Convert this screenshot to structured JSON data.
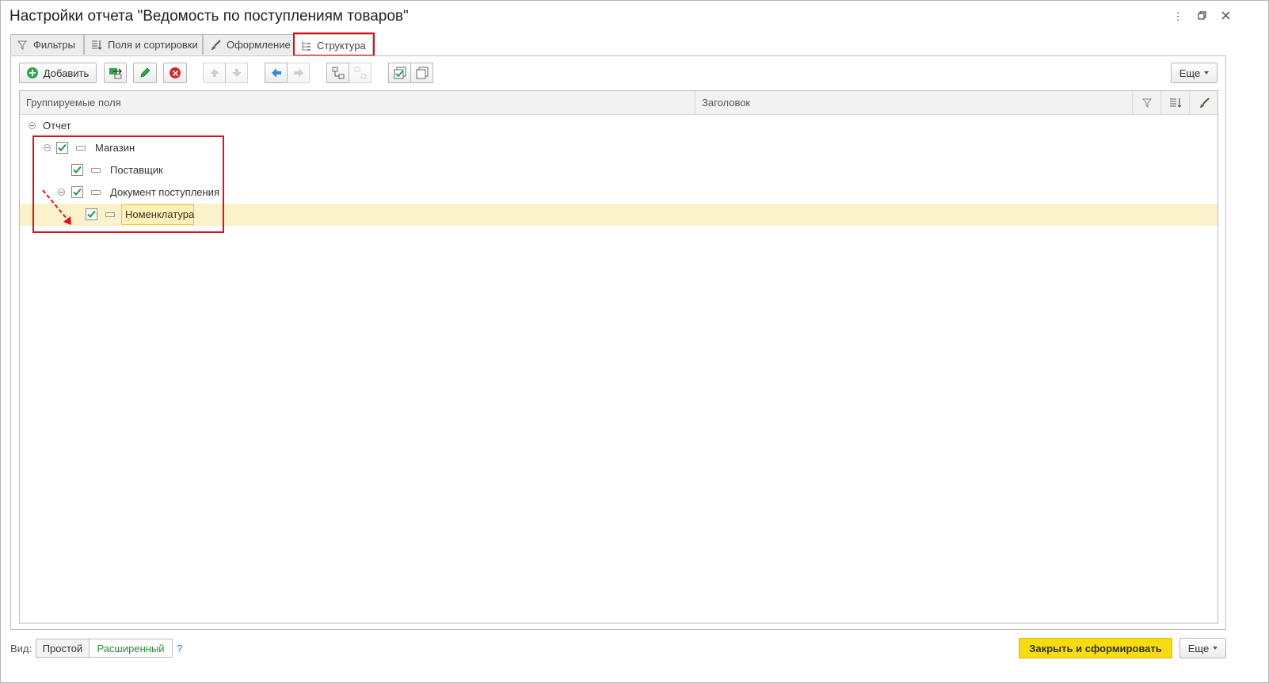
{
  "window": {
    "title": "Настройки отчета \"Ведомость по поступлениям товаров\""
  },
  "tabs": [
    {
      "label": "Фильтры",
      "icon": "filter-icon"
    },
    {
      "label": "Поля и сортировки",
      "icon": "fields-sort-icon"
    },
    {
      "label": "Оформление",
      "icon": "brush-icon"
    },
    {
      "label": "Структура",
      "icon": "structure-icon",
      "active": true
    }
  ],
  "toolbar": {
    "add_label": "Добавить",
    "more_label": "Еще"
  },
  "grid": {
    "columns": [
      "Группируемые поля",
      "Заголовок"
    ],
    "rows": [
      {
        "label": "Отчет",
        "checked": null
      },
      {
        "label": "Магазин",
        "checked": true
      },
      {
        "label": "Поставщик",
        "checked": true
      },
      {
        "label": "Документ поступления",
        "checked": true
      },
      {
        "label": "Номенклатура",
        "checked": true,
        "selected": true
      }
    ]
  },
  "footer": {
    "view_label": "Вид:",
    "view_simple": "Простой",
    "view_extended": "Расширенный",
    "help": "?",
    "primary_label": "Закрыть и сформировать",
    "more_label": "Еще"
  },
  "colors": {
    "accent_red": "#e0101b",
    "selection": "#fbf2cc",
    "primary_button": "#f7dc14",
    "check_green": "#1a9b3a"
  }
}
